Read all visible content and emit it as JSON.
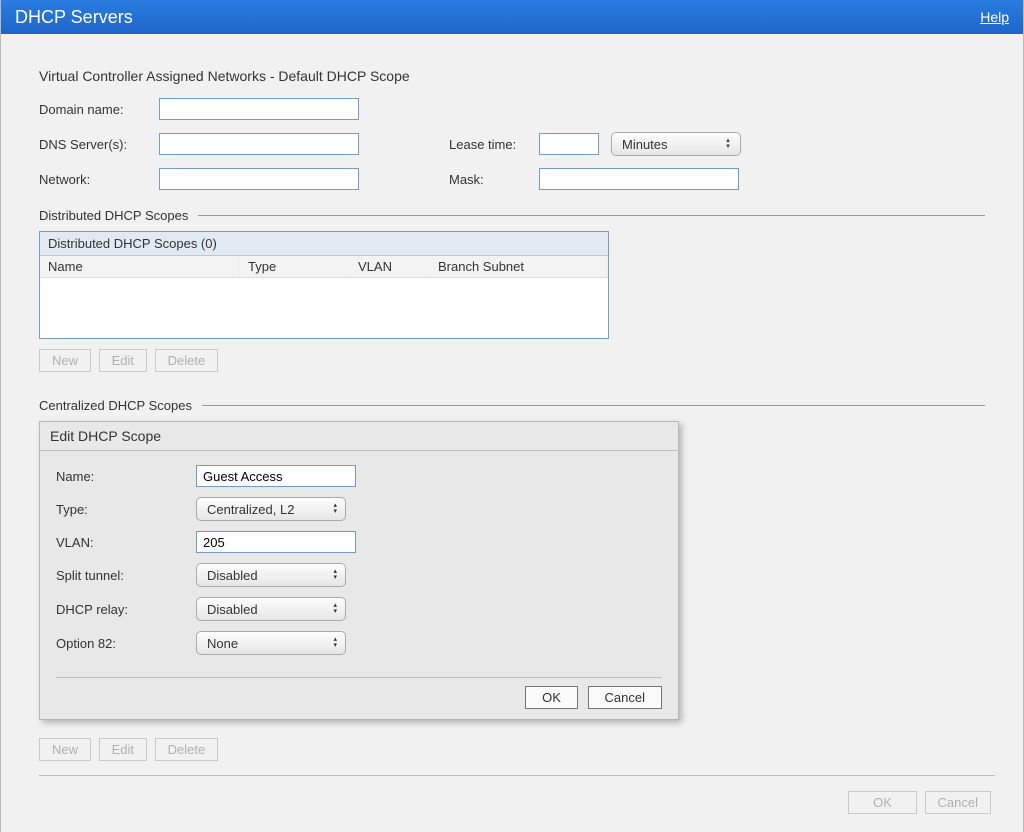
{
  "titlebar": {
    "title": "DHCP Servers",
    "help": "Help"
  },
  "vcan": {
    "section_title": "Virtual Controller Assigned Networks - Default DHCP Scope",
    "domain_label": "Domain name:",
    "dns_label": "DNS Server(s):",
    "network_label": "Network:",
    "lease_label": "Lease time:",
    "lease_unit": "Minutes",
    "mask_label": "Mask:",
    "domain_value": "",
    "dns_value": "",
    "network_value": "",
    "lease_value": "",
    "mask_value": ""
  },
  "distributed": {
    "legend": "Distributed DHCP Scopes",
    "table_title": "Distributed DHCP Scopes (0)",
    "cols": {
      "name": "Name",
      "type": "Type",
      "vlan": "VLAN",
      "branch": "Branch Subnet"
    },
    "buttons": {
      "new_": "New",
      "edit": "Edit",
      "delete_": "Delete"
    }
  },
  "centralized": {
    "legend": "Centralized DHCP Scopes",
    "buttons": {
      "new_": "New",
      "edit": "Edit",
      "delete_": "Delete"
    }
  },
  "dialog": {
    "title": "Edit DHCP Scope",
    "name_label": "Name:",
    "name_value": "Guest Access",
    "type_label": "Type:",
    "type_value": "Centralized, L2",
    "vlan_label": "VLAN:",
    "vlan_value": "205",
    "split_label": "Split tunnel:",
    "split_value": "Disabled",
    "relay_label": "DHCP relay:",
    "relay_value": "Disabled",
    "opt82_label": "Option 82:",
    "opt82_value": "None",
    "ok": "OK",
    "cancel": "Cancel"
  },
  "footer": {
    "ok": "OK",
    "cancel": "Cancel"
  }
}
